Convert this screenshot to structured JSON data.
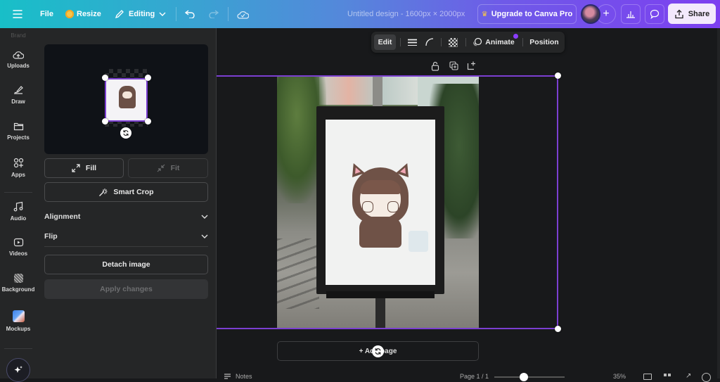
{
  "topbar": {
    "menu_icon": "hamburger-icon",
    "file_label": "File",
    "resize_label": "Resize",
    "editing_label": "Editing",
    "undo_icon": "undo-icon",
    "redo_icon": "redo-icon",
    "cloud_icon": "cloud-saved-icon",
    "design_title": "Untitled design - 1600px × 2000px",
    "upgrade_label": "Upgrade to Canva Pro",
    "add_collaborator_label": "+",
    "share_label": "Share",
    "colors": {
      "gradient_start": "#18bfc8",
      "gradient_end": "#7d3ff0",
      "share_bg": "#f3e9fc"
    }
  },
  "rail": {
    "brand_label": "Brand",
    "items": [
      {
        "label": "Uploads",
        "icon": "cloud-upload-icon"
      },
      {
        "label": "Draw",
        "icon": "pen-draw-icon"
      },
      {
        "label": "Projects",
        "icon": "folder-icon"
      },
      {
        "label": "Apps",
        "icon": "apps-grid-plus-icon"
      },
      {
        "label": "Audio",
        "icon": "music-note-icon"
      },
      {
        "label": "Videos",
        "icon": "video-play-icon"
      },
      {
        "label": "Background",
        "icon": "background-pattern-icon"
      },
      {
        "label": "Mockups",
        "icon": "mockups-app-icon"
      }
    ],
    "magic_icon": "sparkles-icon"
  },
  "panel": {
    "fill_label": "Fill",
    "fit_label": "Fit",
    "smart_crop_label": "Smart Crop",
    "alignment_label": "Alignment",
    "flip_label": "Flip",
    "detach_label": "Detach image",
    "apply_label": "Apply changes"
  },
  "context_toolbar": {
    "edit_label": "Edit",
    "animate_label": "Animate",
    "position_label": "Position",
    "accent": "#8b3dff"
  },
  "canvas": {
    "add_page_label": "+ Add page",
    "selection_color": "#7b3fd1"
  },
  "footer": {
    "notes_label": "Notes",
    "page_label": "Page 1 / 1",
    "zoom_label": "35%"
  }
}
